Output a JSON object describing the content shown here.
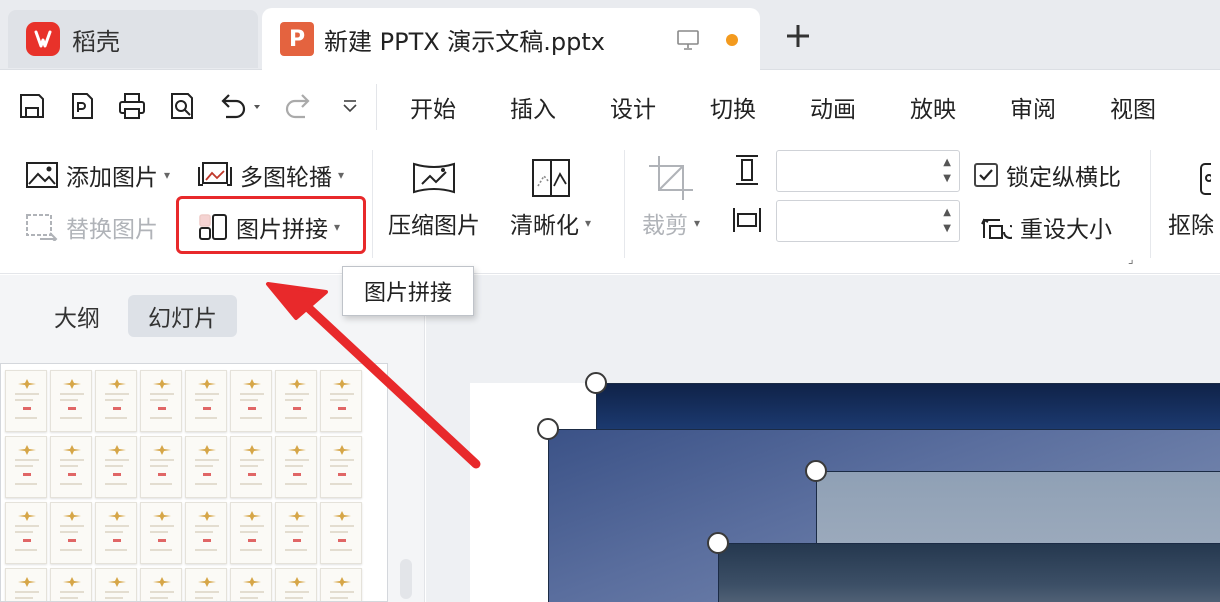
{
  "tabs": {
    "home_label": "稻壳",
    "doc_label": "新建 PPTX 演示文稿.pptx",
    "doc_icon_letter": "P"
  },
  "quick_access": {
    "icons": [
      "save-icon",
      "export-pdf-icon",
      "print-icon",
      "print-preview-icon",
      "undo-icon",
      "redo-icon",
      "customize-icon"
    ]
  },
  "menu": {
    "items": [
      "开始",
      "插入",
      "设计",
      "切换",
      "动画",
      "放映",
      "审阅",
      "视图"
    ]
  },
  "ribbon": {
    "add_picture": "添加图片",
    "multi_carousel": "多图轮播",
    "replace_picture": "替换图片",
    "picture_splice": "图片拼接",
    "compress_picture": "压缩图片",
    "sharpen": "清晰化",
    "crop": "裁剪",
    "lock_aspect": "锁定纵横比",
    "reset_size": "重设大小",
    "cutout": "抠除",
    "height_value": "",
    "width_value": ""
  },
  "tooltip": {
    "text": "图片拼接"
  },
  "left_panel": {
    "tab_outline": "大纲",
    "tab_slides": "幻灯片"
  },
  "colors": {
    "accent_red": "#e8292b",
    "wps_logo": "#e8322a",
    "ppt_icon": "#e4633f",
    "unsaved_dot": "#f39a1e"
  }
}
